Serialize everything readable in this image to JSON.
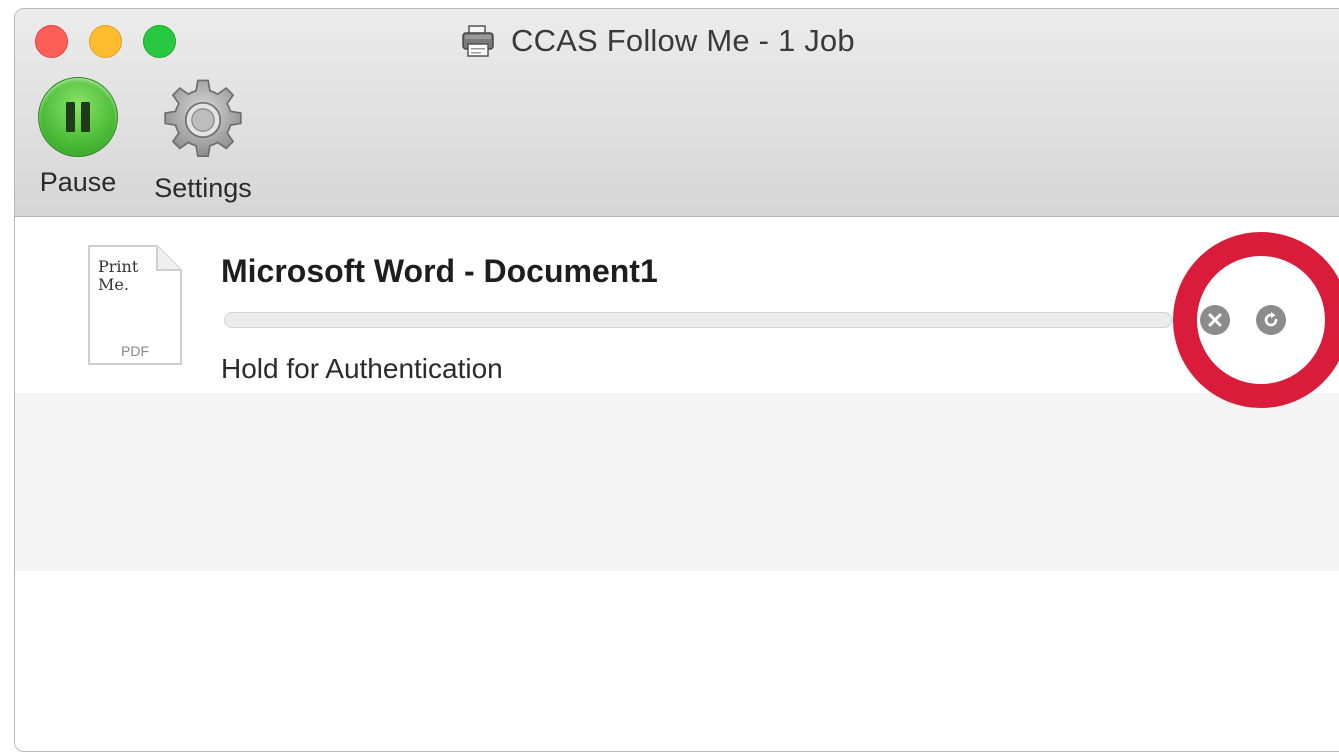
{
  "window": {
    "title": "CCAS Follow Me - 1 Job",
    "title_icon": "printer-icon"
  },
  "toolbar": {
    "pause_label": "Pause",
    "pause_icon": "pause-icon",
    "settings_label": "Settings",
    "settings_icon": "gear-icon"
  },
  "job": {
    "title": "Microsoft Word - Document1",
    "status": "Hold for Authentication",
    "thumbnail_text_line1": "Print",
    "thumbnail_text_line2": "Me.",
    "thumbnail_type": "PDF",
    "progress": 0,
    "cancel_icon": "close-circle-icon",
    "retry_icon": "refresh-icon"
  },
  "colors": {
    "highlight": "#d91c3a",
    "pause_green": "#4fbe3a"
  }
}
